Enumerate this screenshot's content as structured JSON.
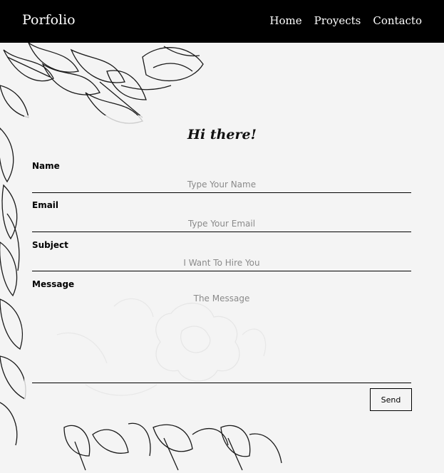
{
  "nav": {
    "brand": "Porfolio",
    "links": [
      "Home",
      "Proyects",
      "Contacto"
    ]
  },
  "form": {
    "greeting": "Hi there!",
    "name": {
      "label": "Name",
      "placeholder": "Type Your Name"
    },
    "email": {
      "label": "Email",
      "placeholder": "Type Your Email"
    },
    "subject": {
      "label": "Subject",
      "placeholder": "I Want To Hire You"
    },
    "message": {
      "label": "Message",
      "placeholder": "The Message"
    },
    "send_label": "Send"
  },
  "colors": {
    "navbar": "#000000",
    "background": "#f4f4f4",
    "floral_line": "#1a1a1a"
  }
}
